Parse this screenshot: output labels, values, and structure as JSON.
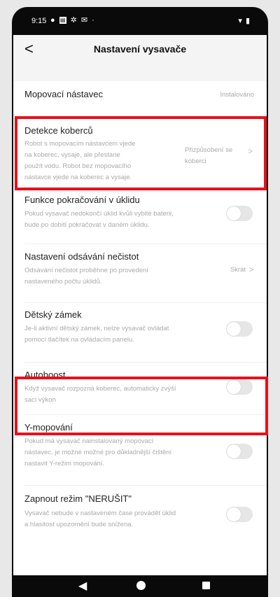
{
  "status": {
    "time": "9:15",
    "icons": [
      "notification-dot",
      "calendar-icon",
      "settings-icon",
      "mail-icon",
      "dot-icon"
    ],
    "right_icons": [
      "wifi-icon",
      "battery-icon"
    ]
  },
  "header": {
    "back": "<",
    "title": "Nastavení vysavače"
  },
  "items": {
    "mop": {
      "title": "Mopovací nástavec",
      "value": "Instalováno"
    },
    "carpet": {
      "title": "Detekce koberců",
      "desc": [
        "Robot  s mopovacím nástavcem vjede",
        "na koberec, vysaje,  ale přestane",
        "použít vodu. Robot bez mopovacího",
        "nástavce vjede na koberec a vysaje."
      ],
      "value_line1": "Přizpůsobení se",
      "value_line2": "koberci"
    },
    "resume": {
      "title": "Funkce pokračování v úklidu",
      "desc": [
        "Pokud vysavač nedokončí úklid kvůli vybité baterii,",
        "bude po dobití pokračovat v daném úklidu."
      ],
      "enabled": false
    },
    "dirt": {
      "title": "Nastavení odsávání nečistot",
      "desc": [
        "Odsávání nečistot proběhne po provedení",
        "nastaveného počtu úklidů."
      ],
      "value": "Skrát"
    },
    "childlock": {
      "title": "Dětský zámek",
      "desc": [
        "Je-li aktivní dětský zámek, nelze vysavač ovládat",
        "pomocí tlačítek na ovládacím panelu."
      ],
      "enabled": false
    },
    "autoboost": {
      "title": "Autoboost",
      "desc": [
        "Když vysavač rozpozná koberec, automaticky zvýší",
        "sací výkon"
      ],
      "enabled": false
    },
    "ymop": {
      "title": "Y-mopování",
      "desc": [
        "Pokud má vysavač nainstalovaný mopovací",
        "nástavec, je možné možné pro důkladnější čištění",
        "nastavit Y-režim mopování."
      ],
      "enabled": false
    },
    "dnd": {
      "title": "Zapnout režim \"NERUŠIT\"",
      "desc": [
        "Vysavač nebude v nastaveném čase provádět úklid",
        "a hlasitost upozornění bude snížena."
      ],
      "enabled": false
    }
  },
  "colors": {
    "highlight": "#e8101b",
    "toggle_off": "#e6e6e6"
  }
}
